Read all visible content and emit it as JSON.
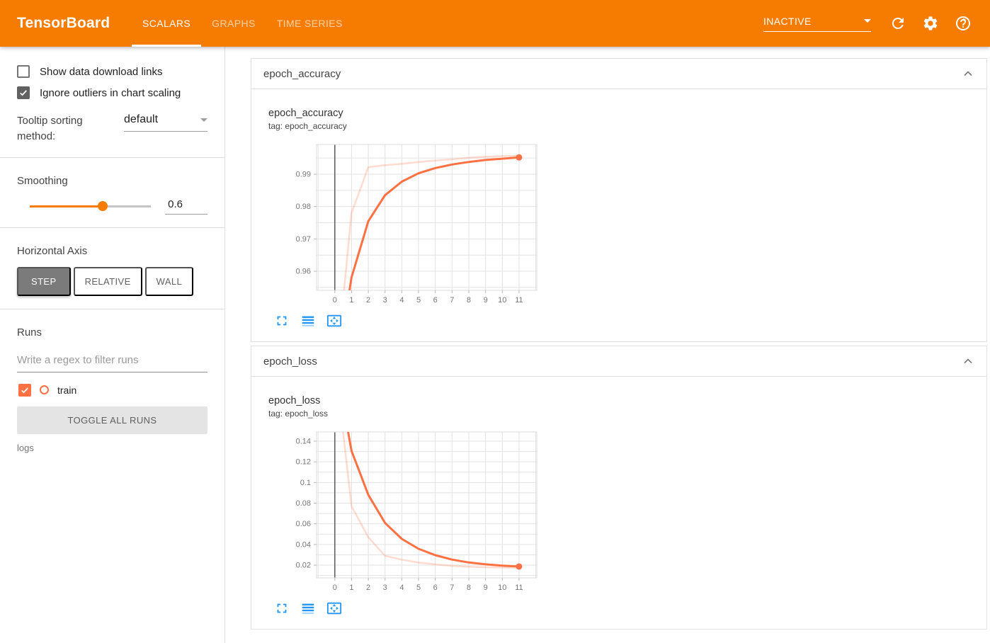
{
  "colors": {
    "header": "#f57c00",
    "run_color": "#ff7043",
    "icon_blue": "#2196f3"
  },
  "header": {
    "logo": "TensorBoard",
    "tabs": [
      {
        "label": "SCALARS",
        "active": true
      },
      {
        "label": "GRAPHS",
        "active": false
      },
      {
        "label": "TIME SERIES",
        "active": false
      }
    ],
    "status": "INACTIVE",
    "icons": [
      "refresh-icon",
      "settings-icon",
      "help-icon"
    ]
  },
  "sidebar": {
    "checkboxes": [
      {
        "label": "Show data download links",
        "checked": false
      },
      {
        "label": "Ignore outliers in chart scaling",
        "checked": true
      }
    ],
    "tooltip_sorting": {
      "label": "Tooltip sorting method:",
      "value": "default"
    },
    "smoothing": {
      "label": "Smoothing",
      "value": "0.6",
      "percent": 60
    },
    "horizontal_axis": {
      "label": "Horizontal Axis",
      "options": [
        {
          "label": "STEP",
          "active": true
        },
        {
          "label": "RELATIVE",
          "active": false
        },
        {
          "label": "WALL",
          "active": false
        }
      ]
    },
    "runs": {
      "label": "Runs",
      "filter_placeholder": "Write a regex to filter runs",
      "items": [
        {
          "label": "train",
          "checked": true,
          "color": "#ff7043"
        }
      ],
      "toggle_button": "TOGGLE ALL RUNS",
      "footer": "logs"
    }
  },
  "cards": [
    {
      "title": "epoch_accuracy",
      "chart": {
        "type": "line",
        "name": "epoch_accuracy",
        "tag": "tag: epoch_accuracy",
        "color": "#ff7043",
        "x": [
          0,
          1,
          2,
          3,
          4,
          5,
          6,
          7,
          8,
          9,
          10,
          11
        ],
        "series": [
          {
            "name": "train",
            "style": "raw",
            "values": [
              0.925,
              0.978,
              0.9922,
              0.9928,
              0.9932,
              0.9938,
              0.9942,
              0.9946,
              0.9951,
              0.9954,
              0.9956,
              0.9957
            ]
          },
          {
            "name": "train (smoothed 0.6)",
            "style": "smoothed",
            "values": [
              0.925,
              0.9581,
              0.9755,
              0.9835,
              0.9877,
              0.9903,
              0.9919,
              0.993,
              0.9938,
              0.9944,
              0.9948,
              0.9952
            ]
          }
        ],
        "xlim": [
          -1.09,
          12.06
        ],
        "ylim": [
          0.9541,
          0.9992
        ],
        "xgrid": [
          -1,
          0,
          1,
          2,
          3,
          4,
          5,
          6,
          7,
          8,
          9,
          10,
          11,
          12
        ],
        "zero_line_x": 0,
        "xticks": [
          0,
          1,
          2,
          3,
          4,
          5,
          6,
          7,
          8,
          9,
          10,
          11
        ],
        "xtick_labels": [
          "0",
          "1",
          "2",
          "3",
          "4",
          "5",
          "6",
          "7",
          "8",
          "9",
          "10",
          "11"
        ],
        "ygrid": [
          0.955,
          0.96,
          0.965,
          0.97,
          0.975,
          0.98,
          0.985,
          0.99,
          0.995
        ],
        "yticks": [
          {
            "v": 0.96,
            "label": "0.96"
          },
          {
            "v": 0.97,
            "label": "0.97"
          },
          {
            "v": 0.98,
            "label": "0.98"
          },
          {
            "v": 0.99,
            "label": "0.99"
          }
        ],
        "end_dot": true,
        "legend": "hidden",
        "grid": true
      }
    },
    {
      "title": "epoch_loss",
      "chart": {
        "type": "line",
        "name": "epoch_loss",
        "tag": "tag: epoch_loss",
        "color": "#ff7043",
        "x": [
          0,
          1,
          2,
          3,
          4,
          5,
          6,
          7,
          8,
          9,
          10,
          11
        ],
        "series": [
          {
            "name": "train",
            "style": "raw",
            "values": [
              0.22,
              0.077,
              0.047,
              0.029,
              0.0253,
              0.0225,
              0.0207,
              0.0193,
              0.0185,
              0.018,
              0.0177,
              0.0175
            ]
          },
          {
            "name": "train (smoothed 0.6)",
            "style": "smoothed",
            "values": [
              0.22,
              0.1306,
              0.088,
              0.0609,
              0.0454,
              0.0358,
              0.0296,
              0.0254,
              0.0226,
              0.0208,
              0.0195,
              0.0187
            ]
          }
        ],
        "xlim": [
          -1.09,
          12.06
        ],
        "ylim": [
          0.0077,
          0.1489
        ],
        "xgrid": [
          -1,
          0,
          1,
          2,
          3,
          4,
          5,
          6,
          7,
          8,
          9,
          10,
          11,
          12
        ],
        "zero_line_x": 0,
        "xticks": [
          0,
          1,
          2,
          3,
          4,
          5,
          6,
          7,
          8,
          9,
          10,
          11
        ],
        "xtick_labels": [
          "0",
          "1",
          "2",
          "3",
          "4",
          "5",
          "6",
          "7",
          "8",
          "9",
          "10",
          "11"
        ],
        "ygrid": [
          0.01,
          0.02,
          0.03,
          0.04,
          0.05,
          0.06,
          0.07,
          0.08,
          0.09,
          0.1,
          0.11,
          0.12,
          0.13,
          0.14
        ],
        "yticks": [
          {
            "v": 0.02,
            "label": "0.02"
          },
          {
            "v": 0.04,
            "label": "0.04"
          },
          {
            "v": 0.06,
            "label": "0.06"
          },
          {
            "v": 0.08,
            "label": "0.08"
          },
          {
            "v": 0.1,
            "label": "0.1"
          },
          {
            "v": 0.12,
            "label": "0.12"
          },
          {
            "v": 0.14,
            "label": "0.14"
          }
        ],
        "end_dot": true,
        "legend": "hidden",
        "grid": true
      }
    }
  ]
}
